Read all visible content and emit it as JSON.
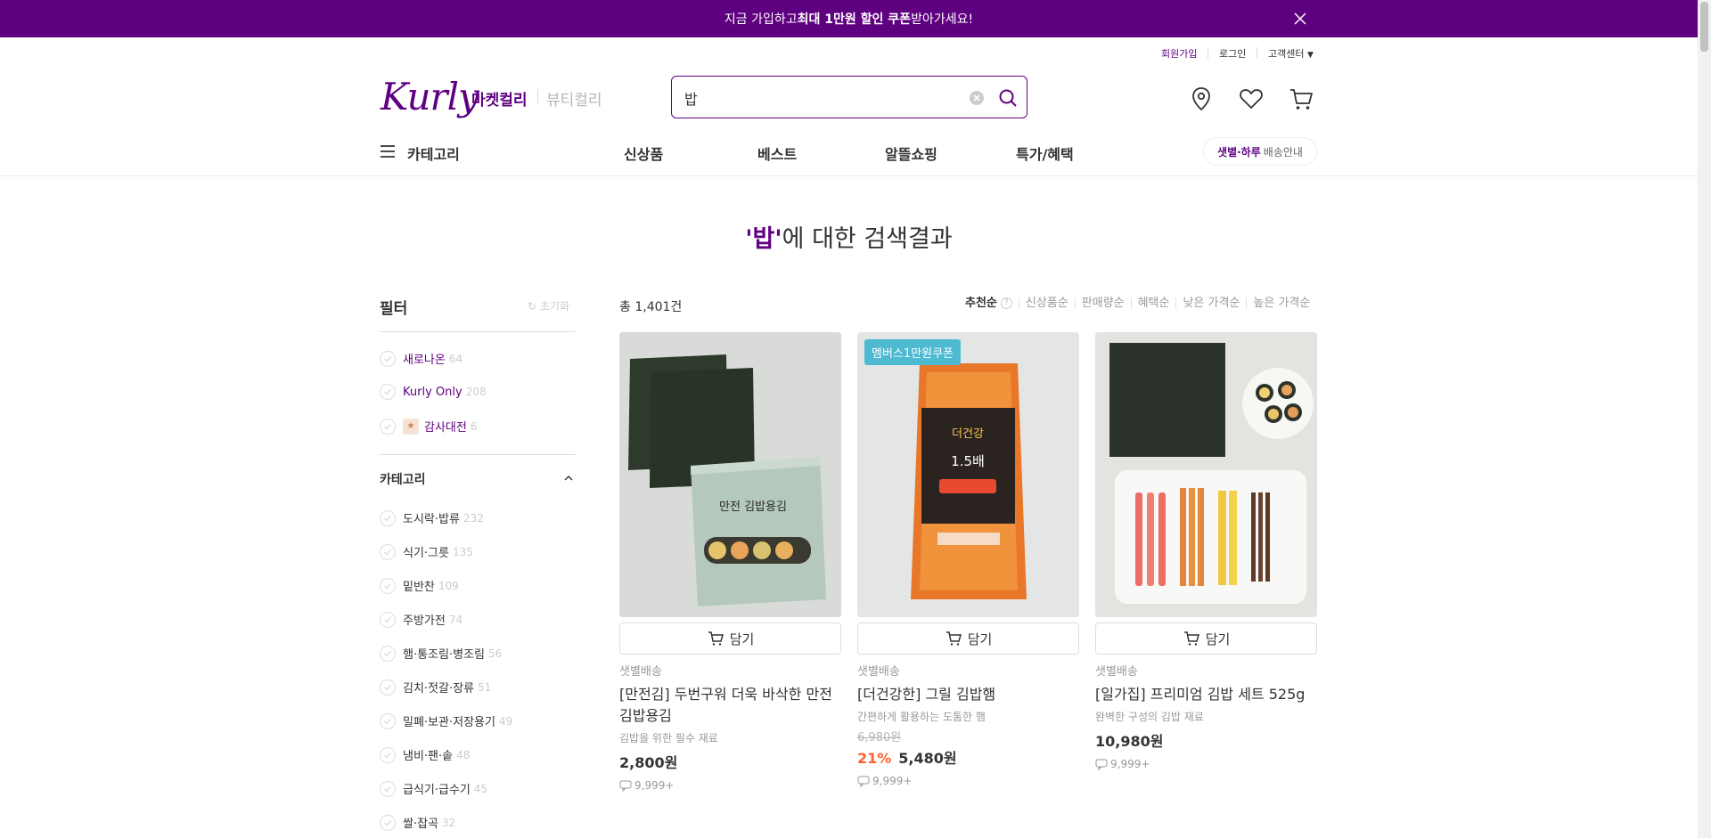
{
  "banner": {
    "pre": "지금 가입하고 ",
    "bold": "최대 1만원 할인 쿠폰",
    "post": " 받아가세요!"
  },
  "util": {
    "signup": "회원가입",
    "login": "로그인",
    "cs": "고객센터"
  },
  "logo": "Kurly",
  "tabs": {
    "market": "마켓컬리",
    "beauty": "뷰티컬리"
  },
  "search": {
    "value": "밥"
  },
  "nav": {
    "category": "카테고리",
    "items": [
      "신상품",
      "베스트",
      "알뜰쇼핑",
      "특가/혜택"
    ],
    "delivery_bold": "샛별·하루",
    "delivery_rest": "배송안내"
  },
  "result": {
    "keyword": "'밥'",
    "suffix": "에 대한 검색결과"
  },
  "filter": {
    "title": "필터",
    "reset": "초기화",
    "flags": [
      {
        "label": "새로나온",
        "count": "64"
      },
      {
        "label": "Kurly Only",
        "count": "208"
      },
      {
        "label": "감사대전",
        "count": "6"
      }
    ],
    "category_title": "카테고리",
    "categories": [
      {
        "label": "도시락·밥류",
        "count": "232"
      },
      {
        "label": "식기·그릇",
        "count": "135"
      },
      {
        "label": "밑반찬",
        "count": "109"
      },
      {
        "label": "주방가전",
        "count": "74"
      },
      {
        "label": "햄·통조림·병조림",
        "count": "56"
      },
      {
        "label": "김치·젓갈·장류",
        "count": "51"
      },
      {
        "label": "밀폐·보관·저장용기",
        "count": "49"
      },
      {
        "label": "냄비·팬·솥",
        "count": "48"
      },
      {
        "label": "급식기·급수기",
        "count": "45"
      },
      {
        "label": "쌀·잡곡",
        "count": "32"
      }
    ]
  },
  "list": {
    "total": "총 1,401건",
    "sorts": [
      "추천순",
      "신상품순",
      "판매량순",
      "혜택순",
      "낮은 가격순",
      "높은 가격순"
    ]
  },
  "products": [
    {
      "cart": "담기",
      "ship": "샛별배송",
      "name": "[만전김] 두번구워 더욱 바삭한 만전 김밥용김",
      "desc": "김밥을 위한 필수 재료",
      "price": "2,800원",
      "reviews": "9,999+"
    },
    {
      "badge": "멤버스1만원쿠폰",
      "cart": "담기",
      "ship": "샛별배송",
      "name": "[더건강한] 그릴 김밥햄",
      "desc": "간편하게 활용하는 도톰한 햄",
      "orig": "6,980원",
      "disc": "21%",
      "price": "5,480원",
      "reviews": "9,999+"
    },
    {
      "cart": "담기",
      "ship": "샛별배송",
      "name": "[일가집] 프리미엄 김밥 세트 525g",
      "desc": "완벽한 구성의 김밥 재료",
      "price": "10,980원",
      "reviews": "9,999+"
    }
  ],
  "colors": {
    "brand": "#5f0080",
    "discount": "#fa622f",
    "badge": "#4dbad1"
  }
}
